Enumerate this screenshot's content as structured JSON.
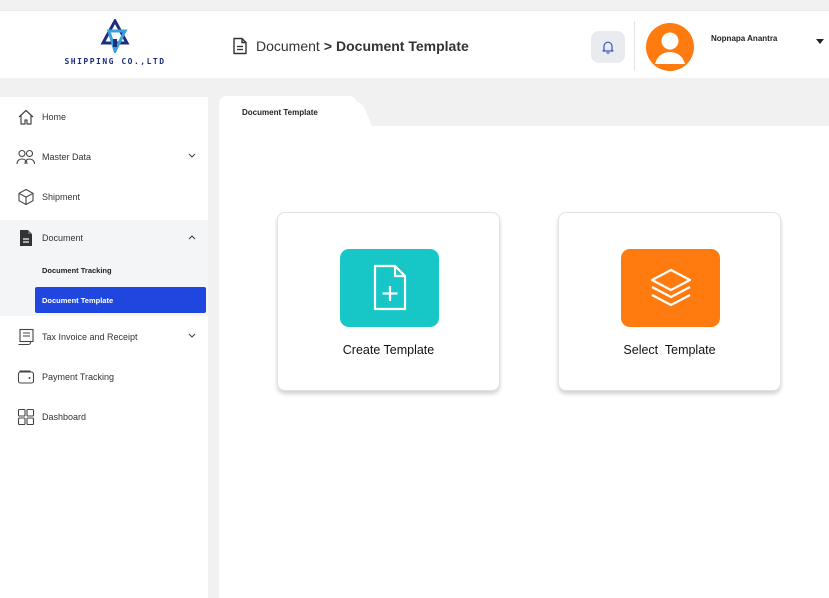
{
  "header": {
    "company": "SHIPPING CO.,LTD",
    "breadcrumb": {
      "parent": "Document",
      "separator": ">",
      "current": "Document Template"
    },
    "user": {
      "name": "Nopnapa Anantra"
    },
    "icons": {
      "notification": "bell-icon",
      "breadcrumb": "document-icon"
    }
  },
  "sidebar": {
    "items": [
      {
        "label": "Home",
        "icon": "home-icon"
      },
      {
        "label": "Master Data",
        "icon": "users-icon"
      },
      {
        "label": "Shipment",
        "icon": "box-icon"
      },
      {
        "label": "Document",
        "icon": "file-icon",
        "expanded": true
      },
      {
        "label": "Tax Invoice and Receipt",
        "icon": "receipt-icon"
      },
      {
        "label": "Payment Tracking",
        "icon": "wallet-icon"
      },
      {
        "label": "Dashboard",
        "icon": "grid-icon"
      }
    ],
    "document_sub": [
      {
        "label": "Document Tracking",
        "active": false
      },
      {
        "label": "Document Template",
        "active": true
      }
    ]
  },
  "main": {
    "tab": "Document Template",
    "cards": [
      {
        "label": "Create Template",
        "icon": "file-plus-icon",
        "color": "#17c7c7"
      },
      {
        "label": "Select  Template",
        "icon": "layers-icon",
        "color": "#ff7a0f"
      }
    ]
  },
  "colors": {
    "accent": "#1f47e0",
    "avatar": "#ff7a0f",
    "brand": "#1d2f7a"
  }
}
